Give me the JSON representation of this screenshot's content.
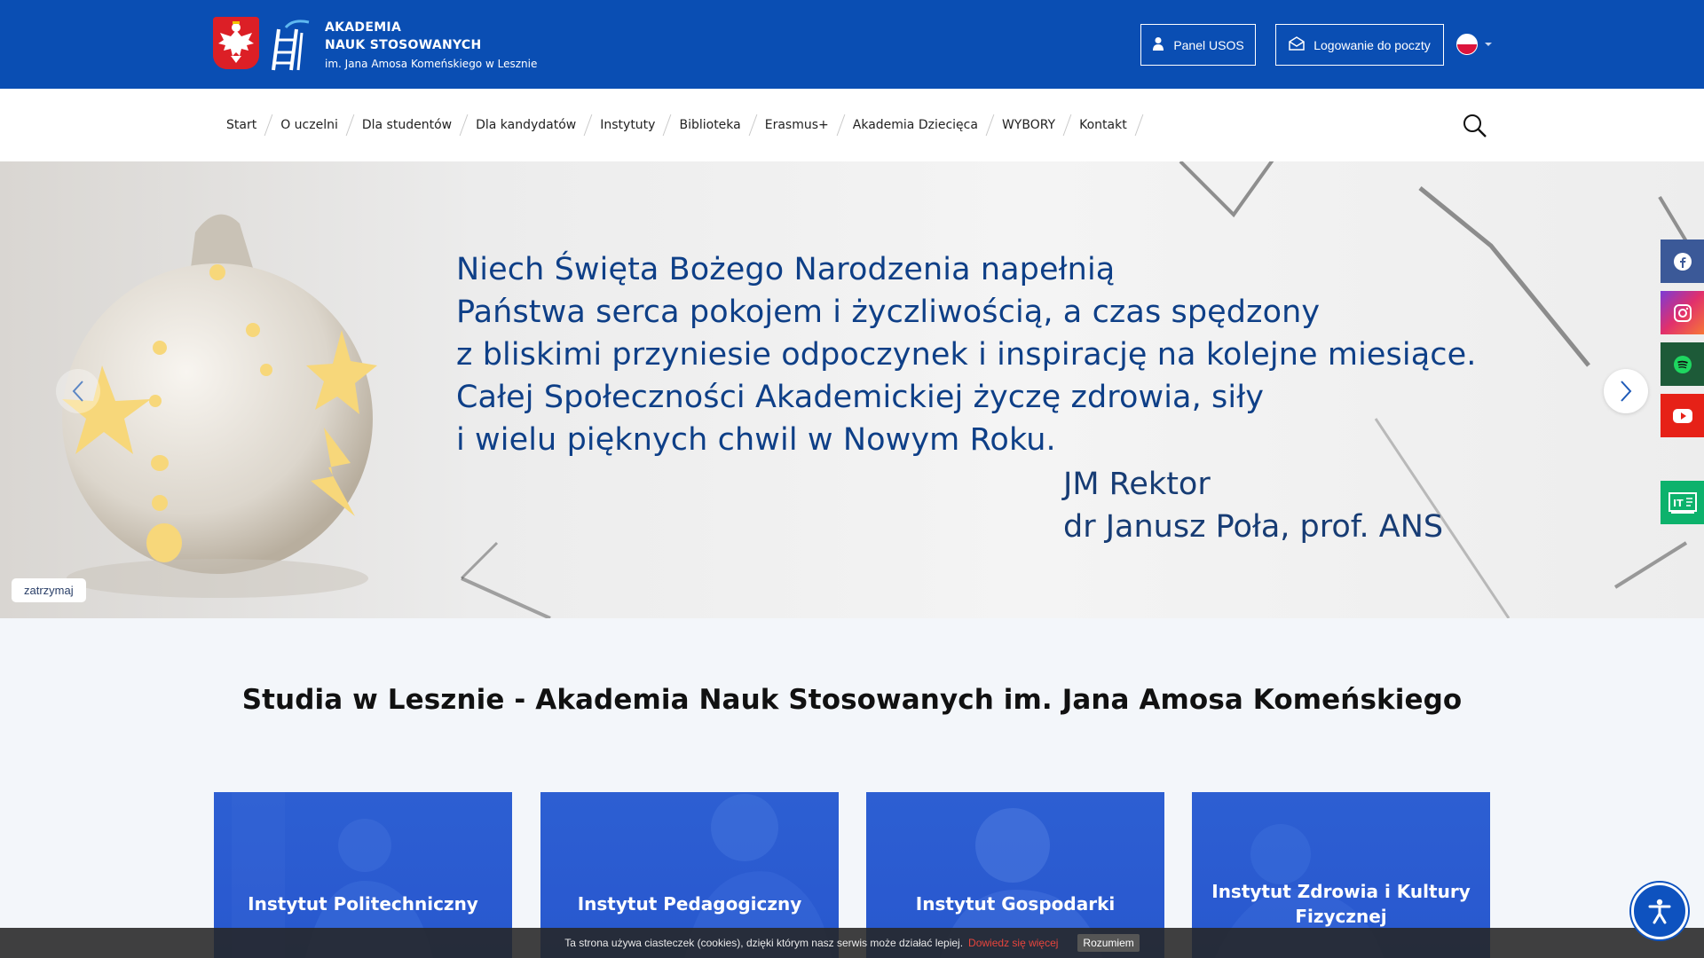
{
  "header": {
    "brand_line1": "AKADEMIA",
    "brand_line2": "NAUK STOSOWANYCH",
    "brand_line3": "im. Jana Amosa Komeńskiego w Lesznie",
    "usos_label": "Panel USOS",
    "mail_label": "Logowanie do poczty",
    "language": "PL"
  },
  "nav": {
    "items": [
      "Start",
      "O uczelni",
      "Dla studentów",
      "Dla kandydatów",
      "Instytuty",
      "Biblioteka",
      "Erasmus+",
      "Akademia Dziecięca",
      "WYBORY",
      "Kontakt"
    ]
  },
  "hero": {
    "lines": [
      "Niech Święta Bożego Narodzenia napełnią",
      "Państwa serca pokojem i życzliwością, a czas spędzony",
      "z bliskimi przyniesie odpoczynek i inspirację na kolejne miesiące.",
      "Całej Społeczności Akademickiej życzę zdrowia, siły",
      "i wielu pięknych chwil w Nowym Roku."
    ],
    "signature_line1": "JM Rektor",
    "signature_line2": "dr Janusz Poła, prof. ANS",
    "pause_label": "zatrzymaj"
  },
  "section": {
    "title": "Studia w Lesznie - Akademia Nauk Stosowanych im. Jana Amosa Komeńskiego"
  },
  "cards": [
    {
      "title_line1": "Instytut Politechniczny",
      "title_line2": ""
    },
    {
      "title_line1": "Instytut Pedagogiczny",
      "title_line2": ""
    },
    {
      "title_line1": "Instytut Gospodarki",
      "title_line2": ""
    },
    {
      "title_line1": "Instytut Zdrowia i Kultury",
      "title_line2": "Fizycznej"
    }
  ],
  "cookie": {
    "text": "Ta strona używa ciasteczek (cookies), dzięki którym nasz serwis może działać lepiej.",
    "more_label": "Dowiedz się więcej",
    "accept_label": "Rozumiem"
  },
  "colors": {
    "brand_blue": "#0a4eb3",
    "hero_text": "#0e3f87",
    "card_blue": "#2a5ad0"
  },
  "icons": {
    "social": [
      "facebook-icon",
      "instagram-icon",
      "spotify-icon",
      "youtube-icon",
      "it-icon"
    ]
  }
}
